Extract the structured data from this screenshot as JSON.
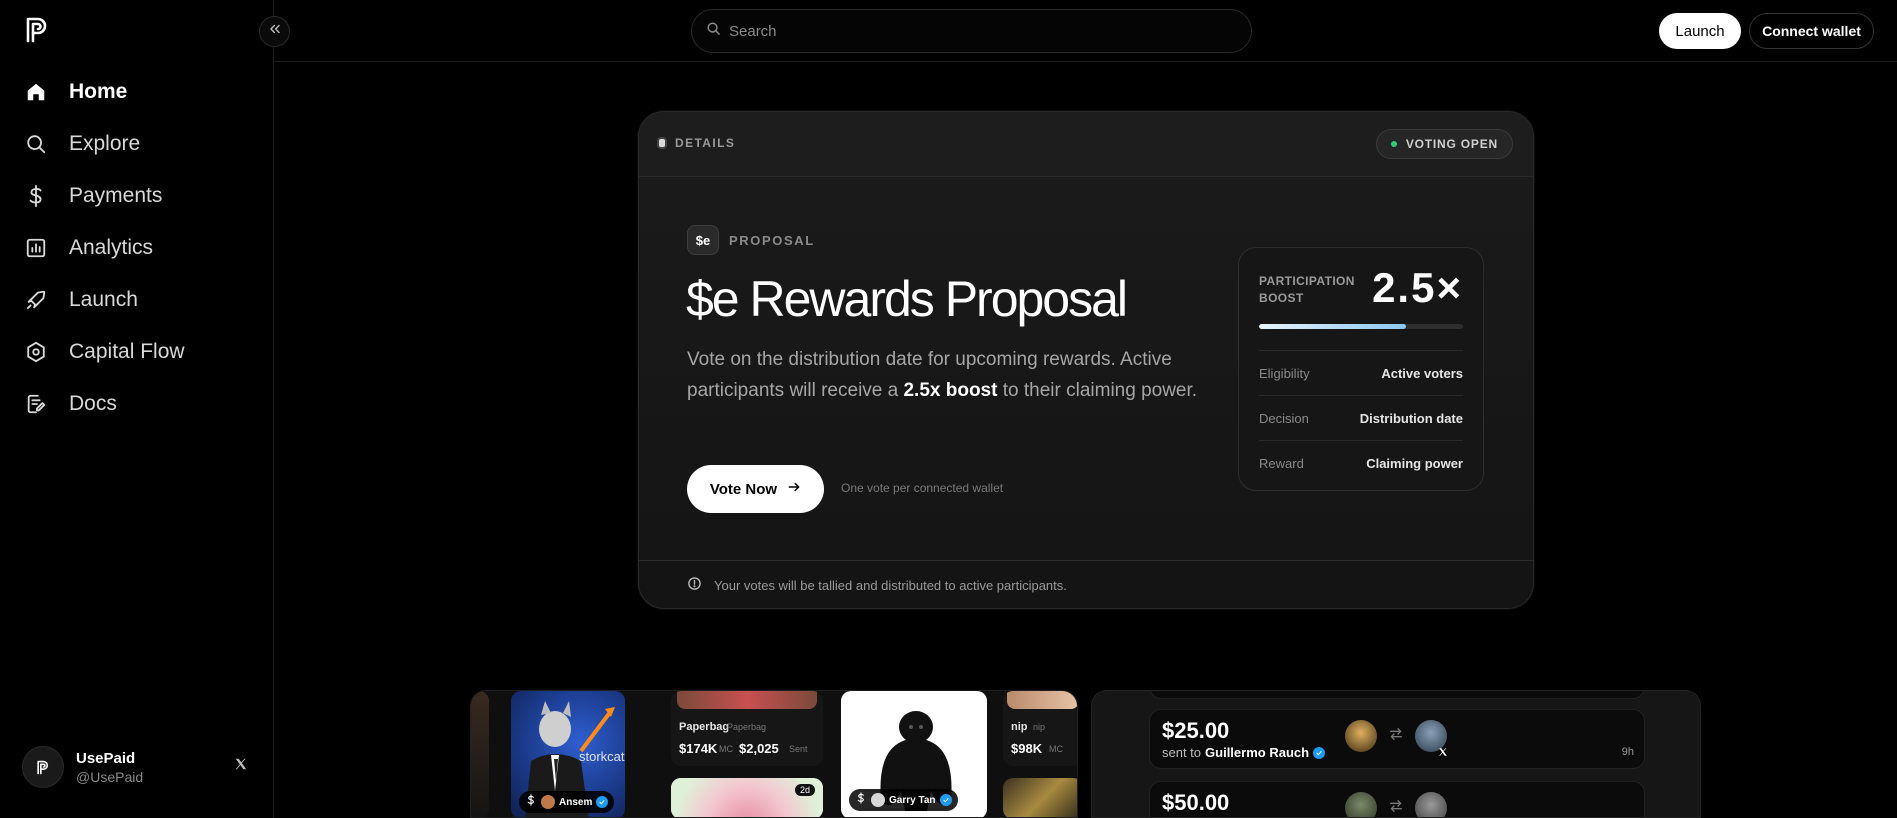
{
  "nav": {
    "items": [
      {
        "label": "Home",
        "icon": "home-icon"
      },
      {
        "label": "Explore",
        "icon": "search-icon"
      },
      {
        "label": "Payments",
        "icon": "dollar-icon"
      },
      {
        "label": "Analytics",
        "icon": "chart-icon"
      },
      {
        "label": "Launch",
        "icon": "rocket-icon"
      },
      {
        "label": "Capital Flow",
        "icon": "hexagon-gear-icon"
      },
      {
        "label": "Docs",
        "icon": "document-edit-icon"
      }
    ]
  },
  "profile": {
    "name": "UsePaid",
    "handle": "@UsePaid"
  },
  "header": {
    "search_placeholder": "Search",
    "launch_label": "Launch",
    "connect_label": "Connect wallet"
  },
  "card": {
    "details_label": "DETAILS",
    "status_label": "VOTING OPEN",
    "badge": "$e",
    "kicker": "PROPOSAL",
    "title": "$e Rewards Proposal",
    "desc_before": "Vote on the distribution date for upcoming rewards. Active participants will receive a ",
    "desc_bold": "2.5x boost",
    "desc_after": " to their claiming power.",
    "vote_label": "Vote Now",
    "vote_hint": "One vote per connected wallet",
    "footer_note": "Your votes will be tallied and distributed to active participants.",
    "stats": {
      "boost_label_1": "PARTICIPATION",
      "boost_label_2": "BOOST",
      "boost_value": "2.5×",
      "boost_progress": 0.72,
      "rows": [
        {
          "key": "Eligibility",
          "value": "Active voters"
        },
        {
          "key": "Decision",
          "value": "Distribution date"
        },
        {
          "key": "Reward",
          "value": "Claiming power"
        }
      ]
    }
  },
  "feed": {
    "tiles": [
      {
        "tag": "Ansem",
        "overlay_text": "storkcat"
      },
      {
        "name": "Paperbag",
        "ticker": "Paperbag",
        "mc": "$174K",
        "mc_unit": "MC",
        "sent": "$2,025",
        "sent_unit": "Sent"
      },
      {
        "badge": "2d"
      },
      {
        "tag": "Garry Tan"
      },
      {
        "name": "nip",
        "ticker": "nip",
        "mc": "$98K",
        "mc_unit": "MC"
      }
    ]
  },
  "payments": [
    {
      "amount": "$25.00",
      "prefix": "sent to",
      "recipient": "Guillermo Rauch",
      "time": "9h"
    },
    {
      "amount": "$50.00"
    }
  ]
}
